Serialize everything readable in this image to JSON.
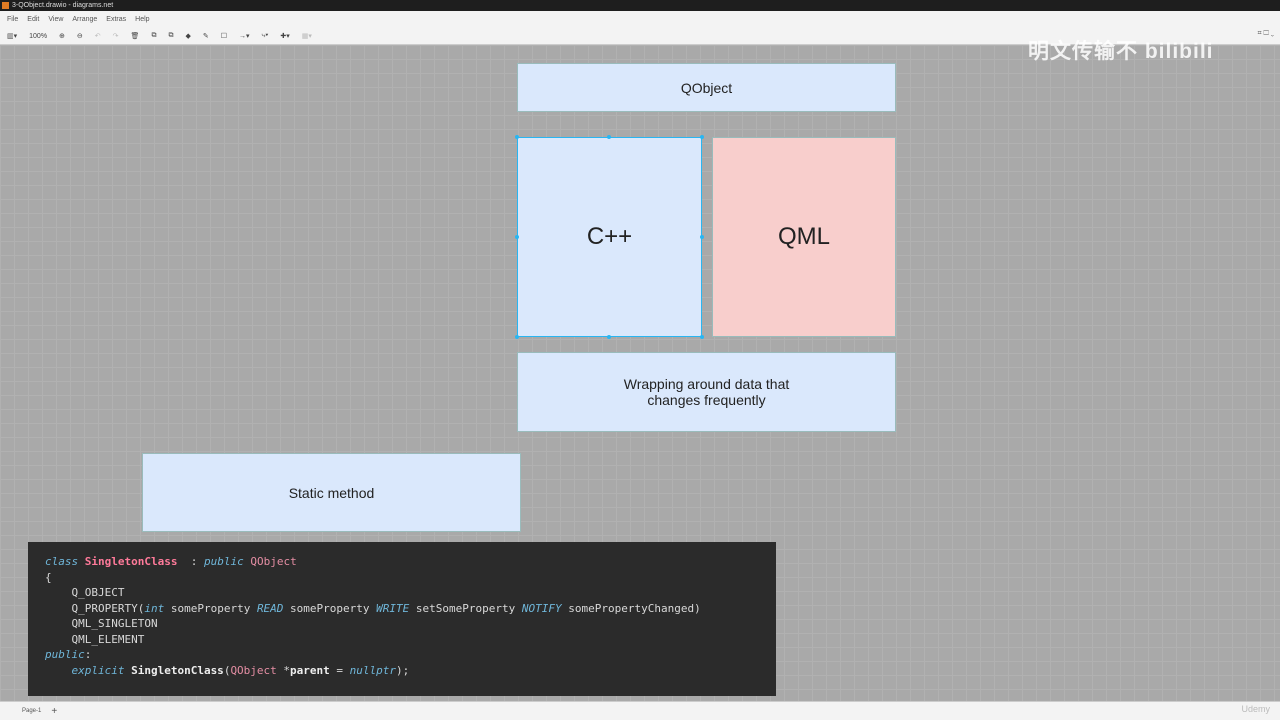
{
  "window": {
    "title": "3-QObject.drawio - diagrams.net"
  },
  "menu": [
    "File",
    "Edit",
    "View",
    "Arrange",
    "Extras",
    "Help"
  ],
  "toolbar": {
    "zoom": "100%"
  },
  "watermark": "明文传输不 bilibili",
  "diagram": {
    "qobject": "QObject",
    "cpp": "C++",
    "qml": "QML",
    "wrapping": "Wrapping around data that changes frequently",
    "static": "Static method"
  },
  "code": {
    "lines": [
      [
        [
          "kw",
          "class "
        ],
        [
          "cl",
          "SingletonClass"
        ],
        [
          "",
          "  : "
        ],
        [
          "kw",
          "public "
        ],
        [
          "ty",
          "QObject"
        ]
      ],
      [
        [
          "",
          "{"
        ]
      ],
      [
        [
          "",
          "    Q_OBJECT"
        ]
      ],
      [
        [
          "",
          "    Q_PROPERTY("
        ],
        [
          "kw",
          "int"
        ],
        [
          "",
          " someProperty "
        ],
        [
          "kw",
          "READ"
        ],
        [
          "",
          " someProperty "
        ],
        [
          "kw",
          "WRITE"
        ],
        [
          "",
          " setSomeProperty "
        ],
        [
          "kw",
          "NOTIFY"
        ],
        [
          "",
          " somePropertyChanged)"
        ]
      ],
      [
        [
          "",
          "    QML_SINGLETON"
        ]
      ],
      [
        [
          "",
          "    QML_ELEMENT"
        ]
      ],
      [
        [
          "kw",
          "public"
        ],
        [
          "",
          ":"
        ]
      ],
      [
        [
          "kw",
          "    explicit "
        ],
        [
          "b",
          "SingletonClass"
        ],
        [
          "",
          "("
        ],
        [
          "ty",
          "QObject"
        ],
        [
          "",
          " *"
        ],
        [
          "b",
          "parent"
        ],
        [
          "",
          " = "
        ],
        [
          "kw",
          "nullptr"
        ],
        [
          "",
          ");"
        ]
      ]
    ]
  },
  "pages": {
    "current": "Page-1",
    "add": "+"
  },
  "brand": "Udemy"
}
